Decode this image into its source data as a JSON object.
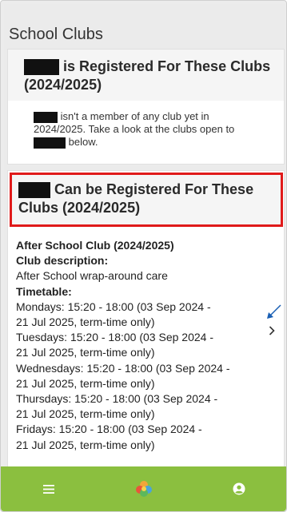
{
  "page": {
    "title": "School Clubs"
  },
  "registered": {
    "title_line1": "is Registered For These Clubs",
    "title_line2": "(2024/2025)",
    "message_line1": "isn't a member of any club yet in",
    "message_line2": "2024/2025. Take a look at the clubs open to",
    "message_line3": "below."
  },
  "available": {
    "title_line1": "Can be Registered For These",
    "title_line2": "Clubs (2024/2025)"
  },
  "club": {
    "name": "After School Club (2024/2025)",
    "description_label": "Club description:",
    "description": "After School wrap-around care",
    "timetable_label": "Timetable:",
    "timetable": [
      {
        "line1": "Mondays: 15:20 - 18:00 (03 Sep 2024 -",
        "line2": "21 Jul 2025, term-time only)"
      },
      {
        "line1": "Tuesdays: 15:20 - 18:00 (03 Sep 2024 -",
        "line2": "21 Jul 2025, term-time only)"
      },
      {
        "line1": "Wednesdays: 15:20 - 18:00 (03 Sep 2024 -",
        "line2": "21 Jul 2025, term-time only)"
      },
      {
        "line1": "Thursdays: 15:20 - 18:00 (03 Sep 2024 -",
        "line2": "21 Jul 2025, term-time only)"
      },
      {
        "line1": "Fridays: 15:20 - 18:00 (03 Sep 2024 -",
        "line2": "21 Jul 2025, term-time only)"
      }
    ]
  },
  "nav": {
    "menu_icon": "hamburger-icon",
    "home_icon": "app-logo-icon",
    "profile_icon": "user-icon"
  },
  "colors": {
    "bottom_bar": "#8bbf3f",
    "highlight": "#e01a1a",
    "annotation_arrow": "#1a5fb4"
  }
}
